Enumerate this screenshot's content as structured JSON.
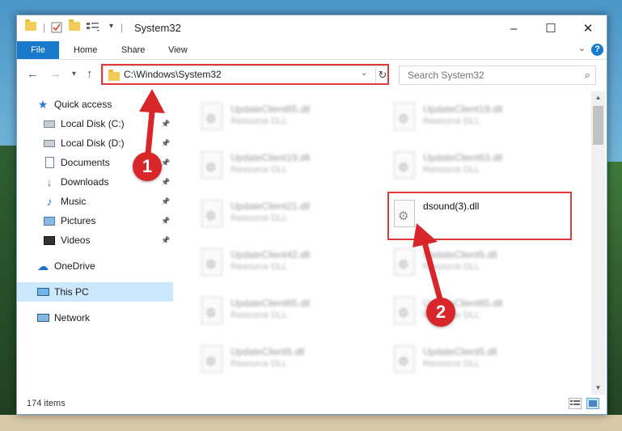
{
  "window": {
    "title": "System32",
    "minimize": "–",
    "maximize": "☐",
    "close": "✕"
  },
  "ribbon": {
    "tabs": [
      "File",
      "Home",
      "Share",
      "View"
    ],
    "help": "?"
  },
  "address": {
    "path": "C:\\Windows\\System32"
  },
  "search": {
    "placeholder": "Search System32"
  },
  "sidebar": {
    "items": [
      {
        "label": "Quick access",
        "icon": "star-icon"
      },
      {
        "label": "Local Disk (C:)",
        "icon": "drive-icon",
        "pinned": true
      },
      {
        "label": "Local Disk (D:)",
        "icon": "drive-icon",
        "pinned": true
      },
      {
        "label": "Documents",
        "icon": "document-icon",
        "pinned": true
      },
      {
        "label": "Downloads",
        "icon": "download-icon",
        "pinned": true
      },
      {
        "label": "Music",
        "icon": "music-icon",
        "pinned": true
      },
      {
        "label": "Pictures",
        "icon": "pictures-icon",
        "pinned": true
      },
      {
        "label": "Videos",
        "icon": "videos-icon",
        "pinned": true
      },
      {
        "label": "OneDrive",
        "icon": "cloud-icon"
      },
      {
        "label": "This PC",
        "icon": "computer-icon",
        "selected": true
      },
      {
        "label": "Network",
        "icon": "network-icon"
      }
    ]
  },
  "files": [
    {
      "name": "UpdateClient65.dll",
      "type": "Resource DLL"
    },
    {
      "name": "UpdateClient19.dll",
      "type": "Resource DLL"
    },
    {
      "name": "UpdateClient19.dll",
      "type": "Resource DLL"
    },
    {
      "name": "UpdateClient63.dll",
      "type": "Resource DLL"
    },
    {
      "name": "UpdateClient21.dll",
      "type": "Resource DLL"
    },
    {
      "name": "dsound(3).dll",
      "type": ""
    },
    {
      "name": "UpdateClient42.dll",
      "type": "Resource DLL"
    },
    {
      "name": "UpdateClient5.dll",
      "type": "Resource DLL"
    },
    {
      "name": "UpdateClient65.dll",
      "type": "Resource DLL"
    },
    {
      "name": "UpdateClient65.dll",
      "type": "Resource DLL"
    },
    {
      "name": "UpdateClient5.dll",
      "type": "Resource DLL"
    },
    {
      "name": "UpdateClient5.dll",
      "type": "Resource DLL"
    }
  ],
  "status": {
    "item_count": "174 items"
  },
  "annotations": {
    "step1": "1",
    "step2": "2",
    "highlight_color": "#e0393b",
    "arrow_color": "#d8262a"
  }
}
